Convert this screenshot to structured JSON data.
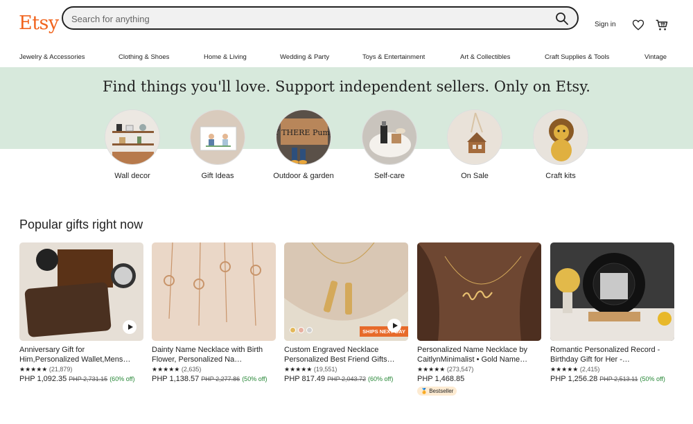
{
  "header": {
    "logo": "Etsy",
    "search_placeholder": "Search for anything",
    "signin": "Sign in"
  },
  "nav": [
    "Jewelry & Accessories",
    "Clothing & Shoes",
    "Home & Living",
    "Wedding & Party",
    "Toys & Entertainment",
    "Art & Collectibles",
    "Craft Supplies & Tools",
    "Vintage"
  ],
  "hero": {
    "title": "Find things you'll love. Support independent sellers. Only on Etsy.",
    "categories": [
      {
        "label": "Wall decor"
      },
      {
        "label": "Gift Ideas"
      },
      {
        "label": "Outdoor & garden"
      },
      {
        "label": "Self-care"
      },
      {
        "label": "On Sale"
      },
      {
        "label": "Craft kits"
      }
    ],
    "doormat_text": "HEY THERE Pumpkin"
  },
  "popular": {
    "title": "Popular gifts right now",
    "items": [
      {
        "title": "Anniversary Gift for Him,Personalized Wallet,Mens…",
        "stars": "★★★★★",
        "count": "(21,879)",
        "price": "PHP 1,092.35",
        "orig": "PHP 2,731.15",
        "off": "(60% off)"
      },
      {
        "title": "Dainty Name Necklace with Birth Flower, Personalized Na…",
        "stars": "★★★★★",
        "count": "(2,635)",
        "price": "PHP 1,138.57",
        "orig": "PHP 2,277.86",
        "off": "(50% off)"
      },
      {
        "title": "Custom Engraved Necklace Personalized Best Friend Gifts…",
        "stars": "★★★★★",
        "count": "(19,551)",
        "price": "PHP 817.49",
        "orig": "PHP 2,043.72",
        "off": "(60% off)",
        "ships": "SHIPS NEXT DAY"
      },
      {
        "title": "Personalized Name Necklace by CaitlynMinimalist • Gold Name…",
        "stars": "★★★★★",
        "count": "(273,547)",
        "price": "PHP 1,468.85",
        "badge": "Bestseller"
      },
      {
        "title": "Romantic Personalized Record - Birthday Gift for Her -…",
        "stars": "★★★★★",
        "count": "(2,415)",
        "price": "PHP 1,256.28",
        "orig": "PHP 2,513.11",
        "off": "(50% off)"
      }
    ]
  },
  "colors": {
    "brand": "#f1641e",
    "hero_band": "#d7e9dc",
    "discount": "#258635"
  }
}
